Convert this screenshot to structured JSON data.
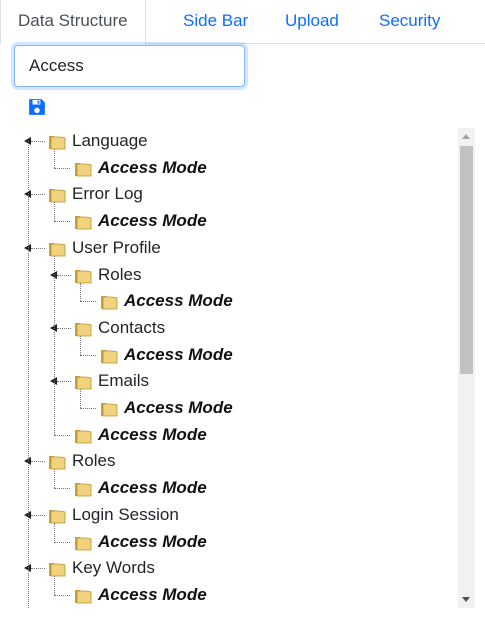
{
  "tabs": [
    {
      "label": "Data Structure",
      "active": true
    },
    {
      "label": "Side Bar",
      "active": false
    },
    {
      "label": "Upload",
      "active": false
    },
    {
      "label": "Security",
      "active": false
    }
  ],
  "search": {
    "value": "Access",
    "placeholder": ""
  },
  "toolbar": {
    "save_icon": "save-icon"
  },
  "tree": [
    {
      "label": "Language",
      "bold": false,
      "level": 0
    },
    {
      "label": "Access Mode",
      "bold": true,
      "level": 1
    },
    {
      "label": "Error Log",
      "bold": false,
      "level": 0
    },
    {
      "label": "Access Mode",
      "bold": true,
      "level": 1
    },
    {
      "label": "User Profile",
      "bold": false,
      "level": 0
    },
    {
      "label": "Roles",
      "bold": false,
      "level": 1
    },
    {
      "label": "Access Mode",
      "bold": true,
      "level": 2
    },
    {
      "label": "Contacts",
      "bold": false,
      "level": 1
    },
    {
      "label": "Access Mode",
      "bold": true,
      "level": 2
    },
    {
      "label": "Emails",
      "bold": false,
      "level": 1
    },
    {
      "label": "Access Mode",
      "bold": true,
      "level": 2
    },
    {
      "label": "Access Mode",
      "bold": true,
      "level": 1
    },
    {
      "label": "Roles",
      "bold": false,
      "level": 0
    },
    {
      "label": "Access Mode",
      "bold": true,
      "level": 1
    },
    {
      "label": "Login Session",
      "bold": false,
      "level": 0
    },
    {
      "label": "Access Mode",
      "bold": true,
      "level": 1
    },
    {
      "label": "Key Words",
      "bold": false,
      "level": 0
    },
    {
      "label": "Access Mode",
      "bold": true,
      "level": 1
    }
  ],
  "colors": {
    "link": "#0d6efd",
    "folder": "#e8c66a",
    "save_icon": "#0d6efd"
  }
}
